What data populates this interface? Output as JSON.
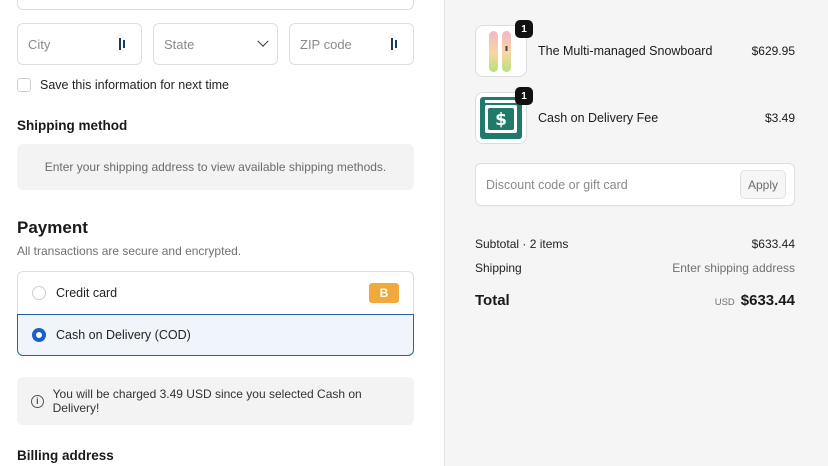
{
  "address": {
    "city_placeholder": "City",
    "state_placeholder": "State",
    "zip_placeholder": "ZIP code",
    "save_info_label": "Save this information for next time"
  },
  "shipping": {
    "heading": "Shipping method",
    "notice": "Enter your shipping address to view available shipping methods."
  },
  "payment": {
    "heading": "Payment",
    "subtitle": "All transactions are secure and encrypted.",
    "options": [
      {
        "label": "Credit card",
        "badge": "B",
        "selected": false
      },
      {
        "label": "Cash on Delivery (COD)",
        "selected": true
      }
    ],
    "info": "You will be charged 3.49 USD since you selected Cash on Delivery!"
  },
  "billing": {
    "heading": "Billing address"
  },
  "summary": {
    "items": [
      {
        "name": "The Multi-managed Snowboard",
        "price": "$629.95",
        "quantity": "1",
        "icon": "snowboard-icon"
      },
      {
        "name": "Cash on Delivery Fee",
        "price": "$3.49",
        "quantity": "1",
        "icon": "cash-register-icon"
      }
    ],
    "discount_placeholder": "Discount code or gift card",
    "apply_label": "Apply",
    "subtotal_label": "Subtotal · 2 items",
    "subtotal_value": "$633.44",
    "shipping_label": "Shipping",
    "shipping_value": "Enter shipping address",
    "total_label": "Total",
    "currency": "USD",
    "total_value": "$633.44"
  },
  "colors": {
    "selected_border": "#2a5ea8",
    "radio_active": "#1d5fc7",
    "badge": "#f2a93b",
    "register_green": "#1f7a6a"
  }
}
